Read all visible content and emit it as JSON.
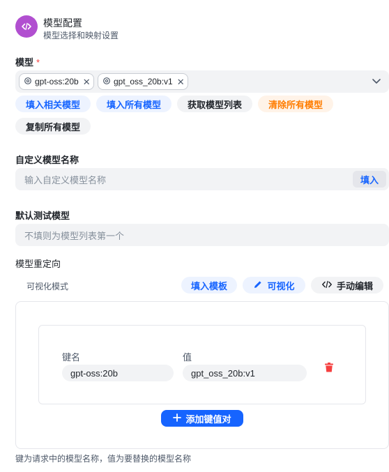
{
  "header": {
    "title": "模型配置",
    "subtitle": "模型选择和映射设置",
    "icon": "code-icon",
    "icon_color": "#b14fd0"
  },
  "models": {
    "label": "模型",
    "required_mark": "*",
    "selected": [
      "gpt-oss:20b",
      "gpt_oss_20b:v1"
    ],
    "actions": {
      "fill_related": "填入相关模型",
      "fill_all": "填入所有模型",
      "fetch_list": "获取模型列表",
      "clear_all": "清除所有模型",
      "copy_all": "复制所有模型"
    }
  },
  "custom_name": {
    "label": "自定义模型名称",
    "placeholder": "输入自定义模型名称",
    "fill_label": "填入"
  },
  "default_test": {
    "label": "默认测试模型",
    "placeholder": "不填则为模型列表第一个"
  },
  "redirect": {
    "label": "模型重定向",
    "mode_label": "可视化模式",
    "fill_template": "填入模板",
    "visual": "可视化",
    "manual_edit": "手动编辑",
    "key_label": "键名",
    "value_label": "值",
    "entries": [
      {
        "key": "gpt-oss:20b",
        "value": "gpt_oss_20b:v1"
      }
    ],
    "add_label": "添加键值对",
    "hint": "键为请求中的模型名称，值为要替换的模型名称"
  },
  "colors": {
    "accent": "#1664ff",
    "warning": "#ff7d00",
    "danger": "#f53f3f"
  }
}
